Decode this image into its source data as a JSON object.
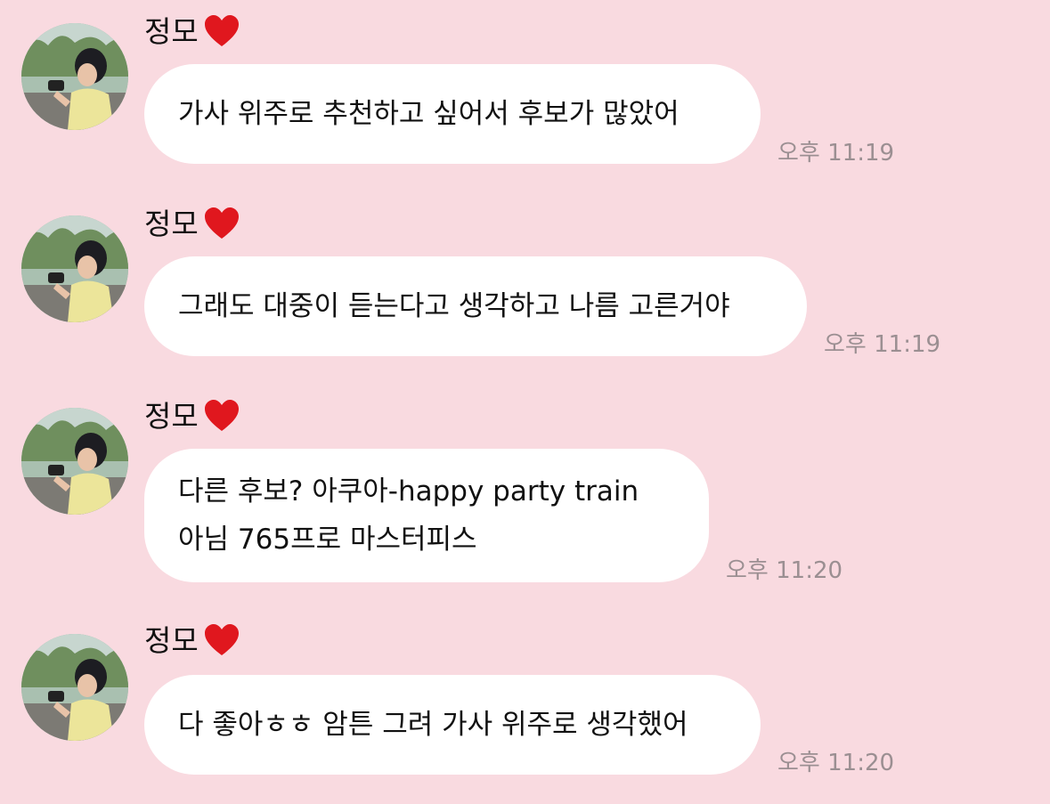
{
  "colors": {
    "background": "#f9dae0",
    "bubble": "#ffffff",
    "heart": "#e0171e",
    "timestamp": "#9b8f92"
  },
  "messages": [
    {
      "sender": "정모",
      "sender_icon": "red-heart-icon",
      "lines": [
        "가사 위주로 추천하고 싶어서 후보가 많았어"
      ],
      "time": "오후 11:19"
    },
    {
      "sender": "정모",
      "sender_icon": "red-heart-icon",
      "lines": [
        "그래도 대중이 듣는다고 생각하고 나름 고른거야"
      ],
      "time": "오후 11:19"
    },
    {
      "sender": "정모",
      "sender_icon": "red-heart-icon",
      "lines": [
        "다른 후보? 아쿠아-happy party train",
        "아님 765프로 마스터피스"
      ],
      "time": "오후 11:20"
    },
    {
      "sender": "정모",
      "sender_icon": "red-heart-icon",
      "lines": [
        "다 좋아ㅎㅎ 암튼 그려 가사 위주로 생각했어"
      ],
      "time": "오후 11:20"
    }
  ]
}
